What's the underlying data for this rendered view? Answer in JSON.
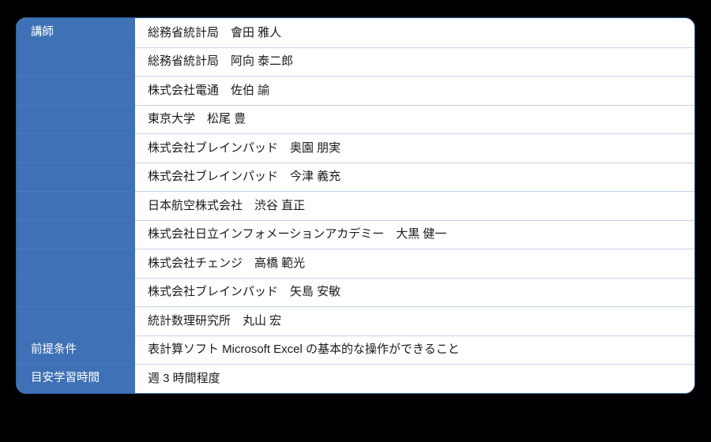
{
  "table": {
    "accent_color": "#3e71b5",
    "border_color": "#2f62ad",
    "separator_color": "#c5d3e8",
    "background_color": "#ffffff",
    "page_background_color": "#000000",
    "labels": {
      "instructors": "講師",
      "prerequisites": "前提条件",
      "study_time": "目安学習時間"
    },
    "rows": [
      {
        "label": "講師",
        "label_visible": true,
        "value": "総務省統計局　會田 雅人"
      },
      {
        "label": "講師",
        "label_visible": false,
        "value": "総務省統計局　阿向 泰二郎"
      },
      {
        "label": "講師",
        "label_visible": false,
        "value": "株式会社電通　佐伯 諭"
      },
      {
        "label": "講師",
        "label_visible": false,
        "value": "東京大学　松尾 豊"
      },
      {
        "label": "講師",
        "label_visible": false,
        "value": "株式会社ブレインパッド　奥園 朋実"
      },
      {
        "label": "講師",
        "label_visible": false,
        "value": "株式会社ブレインパッド　今津 義充"
      },
      {
        "label": "講師",
        "label_visible": false,
        "value": "日本航空株式会社　渋谷 直正"
      },
      {
        "label": "講師",
        "label_visible": false,
        "value": "株式会社日立インフォメーションアカデミー　大黒 健一"
      },
      {
        "label": "講師",
        "label_visible": false,
        "value": "株式会社チェンジ　高橋 範光"
      },
      {
        "label": "講師",
        "label_visible": false,
        "value": "株式会社ブレインパッド　矢島 安敏"
      },
      {
        "label": "講師",
        "label_visible": false,
        "value": "統計数理研究所　丸山 宏"
      },
      {
        "label": "前提条件",
        "label_visible": true,
        "value": "表計算ソフト Microsoft Excel の基本的な操作ができること"
      },
      {
        "label": "目安学習時間",
        "label_visible": true,
        "value": "週 3 時間程度"
      }
    ]
  }
}
